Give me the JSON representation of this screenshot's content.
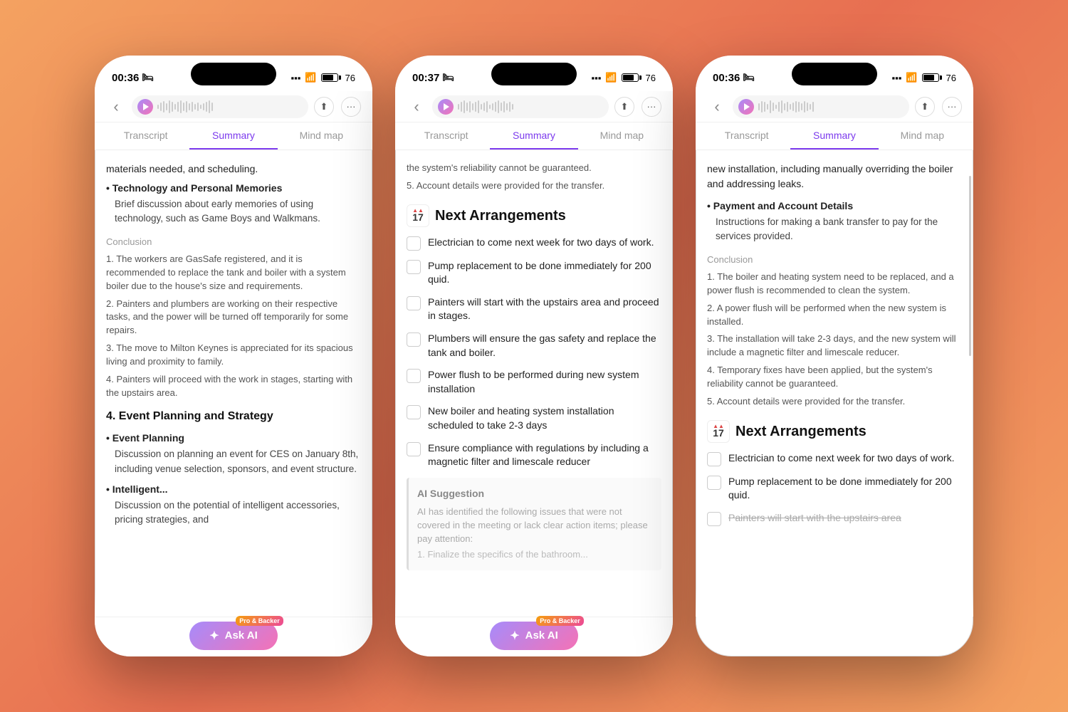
{
  "phones": [
    {
      "id": "left",
      "statusBar": {
        "time": "00:36",
        "bedIcon": "🛏",
        "signal": "●●●",
        "wifi": "wifi",
        "battery": "76"
      },
      "tabs": [
        {
          "label": "Transcript",
          "active": false
        },
        {
          "label": "Summary",
          "active": true
        },
        {
          "label": "Mind map",
          "active": false
        }
      ],
      "content": {
        "type": "summary-left",
        "sections": [
          {
            "bulletTitle": "Technology and Personal Memories",
            "bulletDesc": "Brief discussion about early memories of using technology, such as Game Boys and Walkmans."
          }
        ],
        "conclusion": {
          "label": "Conclusion",
          "items": [
            "1. The workers are GasSafe registered, and it is recommended to replace the tank and boiler with a system boiler due to the house's size and requirements.",
            "2. Painters and plumbers are working on their respective tasks, and the power will be turned off temporarily for some repairs.",
            "3. The move to Milton Keynes is appreciated for its spacious living and proximity to family.",
            "4. Painters will proceed with the work in stages, starting with the upstairs area."
          ]
        },
        "eventSection": {
          "heading": "4. Event Planning and Strategy",
          "bullets": [
            {
              "title": "Event Planning",
              "desc": "Discussion on planning an event for CES on January 8th, including venue selection, sponsors, and event structure."
            },
            {
              "title": "Intelligent...",
              "desc": "Discussion on the potential of intelligent accessories, pricing strategies, and"
            }
          ]
        }
      },
      "askAI": {
        "label": "Ask AI",
        "proBadge": "Pro & Backer"
      }
    },
    {
      "id": "middle",
      "statusBar": {
        "time": "00:37",
        "bedIcon": "🛏",
        "signal": "●●●",
        "wifi": "wifi",
        "battery": "76"
      },
      "tabs": [
        {
          "label": "Transcript",
          "active": false
        },
        {
          "label": "Summary",
          "active": true
        },
        {
          "label": "Mind map",
          "active": false
        }
      ],
      "content": {
        "type": "next-arrangements",
        "introItems": [
          "the system's reliability cannot be guaranteed.",
          "5. Account details were provided for the transfer."
        ],
        "nextArrangements": {
          "title": "Next Arrangements",
          "calendarDay": "17",
          "items": [
            "Electrician to come next week for two days of work.",
            "Pump replacement to be done immediately for 200 quid.",
            "Painters will start with the upstairs area and proceed in stages.",
            "Plumbers will ensure the gas safety and replace the tank and boiler.",
            "Power flush to be performed during new system installation",
            "New boiler and heating system installation scheduled to take 2-3 days",
            "Ensure compliance with regulations by including a magnetic filter and limescale reducer"
          ]
        },
        "aiSuggestion": {
          "title": "AI Suggestion",
          "text": "AI has identified the following issues that were not covered in the meeting or lack clear action items; please pay attention:",
          "subItem": "1. Finalize the specifics of the bathroom..."
        }
      },
      "askAI": {
        "label": "Ask AI",
        "proBadge": "Pro & Backer"
      }
    },
    {
      "id": "right",
      "statusBar": {
        "time": "00:36",
        "bedIcon": "🛏",
        "signal": "●●●",
        "wifi": "wifi",
        "battery": "76"
      },
      "tabs": [
        {
          "label": "Transcript",
          "active": false
        },
        {
          "label": "Summary",
          "active": true
        },
        {
          "label": "Mind map",
          "active": false
        }
      ],
      "content": {
        "type": "summary-right",
        "introText": "new installation, including manually overriding the boiler and addressing leaks.",
        "sections": [
          {
            "bulletTitle": "Payment and Account Details",
            "bulletDesc": "Instructions for making a bank transfer to pay for the services provided."
          }
        ],
        "conclusion": {
          "label": "Conclusion",
          "items": [
            "1. The boiler and heating system need to be replaced, and a power flush is recommended to clean the system.",
            "2. A power flush will be performed when the new system is installed.",
            "3. The installation will take 2-3 days, and the new system will include a magnetic filter and limescale reducer.",
            "4. Temporary fixes have been applied, but the system's reliability cannot be guaranteed.",
            "5. Account details were provided for the transfer."
          ]
        },
        "nextArrangements": {
          "title": "Next Arrangements",
          "calendarDay": "17",
          "items": [
            {
              "text": "Electrician to come next week for two days of work.",
              "strikethrough": false
            },
            {
              "text": "Pump replacement to be done immediately for 200 quid.",
              "strikethrough": false
            },
            {
              "text": "Painters will start with the upstairs area",
              "strikethrough": true
            }
          ]
        }
      },
      "askAI": null
    }
  ]
}
